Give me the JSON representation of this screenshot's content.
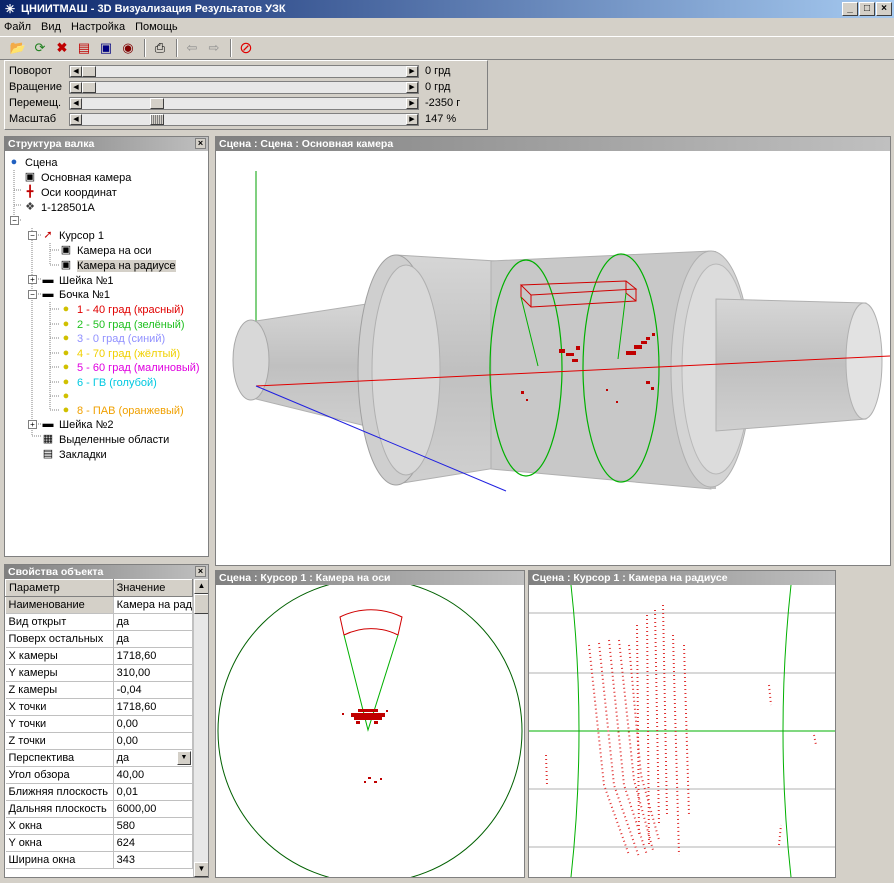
{
  "window": {
    "title": "ЦНИИТМАШ - 3D Визуализация Результатов УЗК",
    "app_icon": "snowflake-icon",
    "buttons": {
      "minimize": "_",
      "maximize": "□",
      "close": "×"
    }
  },
  "menu": [
    "Файл",
    "Вид",
    "Настройка",
    "Помощь"
  ],
  "toolbar_icons": [
    "open-folder-icon",
    "refresh-icon",
    "delete-icon",
    "export-icon",
    "save-icon",
    "print-preview-icon",
    "print-icon",
    "back-icon",
    "forward-icon",
    "stop-icon"
  ],
  "sliders": [
    {
      "label": "Поворот",
      "value": "0 грд",
      "position": 0.02
    },
    {
      "label": "Вращение",
      "value": "0 грд",
      "position": 0.02
    },
    {
      "label": "Перемещ.",
      "value": "-2350 г",
      "position": 0.23
    },
    {
      "label": "Масштаб",
      "value": "147 %",
      "position": 0.23
    }
  ],
  "tree_panel": {
    "title": "Структура валка",
    "items": [
      {
        "label": "Сцена",
        "icon": "globe-icon"
      },
      {
        "label": "Основная камера",
        "icon": "camera-icon"
      },
      {
        "label": "Оси координат",
        "icon": "axes-icon"
      },
      {
        "label": "1-128501А",
        "icon": "part-icon"
      },
      {
        "label": "Курсор 1",
        "icon": "cursor-arrow-icon"
      },
      {
        "label": "Камера на оси",
        "icon": "camera-icon"
      },
      {
        "label": "Камера на радиусе",
        "icon": "camera-icon"
      },
      {
        "label": "Шейка №1",
        "icon": "ruler-icon"
      },
      {
        "label": "Бочка №1",
        "icon": "ruler-icon"
      },
      {
        "label": "1 - 40 град (красный)",
        "icon": "bulb-icon",
        "color": "#e00000"
      },
      {
        "label": "2 - 50 град (зелёный)",
        "icon": "bulb-icon",
        "color": "#20c020"
      },
      {
        "label": "3 - 0  град (синий)",
        "icon": "bulb-icon",
        "color": "#9090ff"
      },
      {
        "label": "4 - 70 град (жёлтый)",
        "icon": "bulb-icon",
        "color": "#f0d000"
      },
      {
        "label": "5 - 60 град (малиновый)",
        "icon": "bulb-icon",
        "color": "#e000e0"
      },
      {
        "label": "6 - ГВ (голубой)",
        "icon": "bulb-icon",
        "color": "#00c8e0"
      },
      {
        "label": "",
        "icon": "bulb-icon",
        "color": "#000000"
      },
      {
        "label": "8 - ПАВ (оранжевый)",
        "icon": "bulb-icon",
        "color": "#f0a000"
      },
      {
        "label": "Шейка №2",
        "icon": "ruler-icon"
      },
      {
        "label": "Выделенные области",
        "icon": "regions-icon"
      },
      {
        "label": "Закладки",
        "icon": "bookmarks-icon"
      }
    ]
  },
  "props_panel": {
    "title": "Свойства объекта",
    "headers": [
      "Параметр",
      "Значение"
    ],
    "rows": [
      [
        "Наименование",
        "Камера на рад"
      ],
      [
        "Вид открыт",
        "да"
      ],
      [
        "Поверх остальных",
        "да"
      ],
      [
        "X камеры",
        "1718,60"
      ],
      [
        "Y камеры",
        "310,00"
      ],
      [
        "Z камеры",
        "-0,04"
      ],
      [
        "X точки",
        "1718,60"
      ],
      [
        "Y точки",
        "0,00"
      ],
      [
        "Z точки",
        "0,00"
      ],
      [
        "Перспектива",
        "да"
      ],
      [
        "Угол обзора",
        "40,00"
      ],
      [
        "Ближняя плоскость",
        "0,01"
      ],
      [
        "Дальняя плоскость",
        "6000,00"
      ],
      [
        "X окна",
        "580"
      ],
      [
        "Y окна",
        "624"
      ],
      [
        "Ширина окна",
        "343"
      ]
    ]
  },
  "views": {
    "main": "Сцена : Сцена : Основная камера",
    "axis": "Сцена : Курсор 1 : Камера на оси",
    "radius": "Сцена : Курсор 1 : Камера на радиусе"
  }
}
